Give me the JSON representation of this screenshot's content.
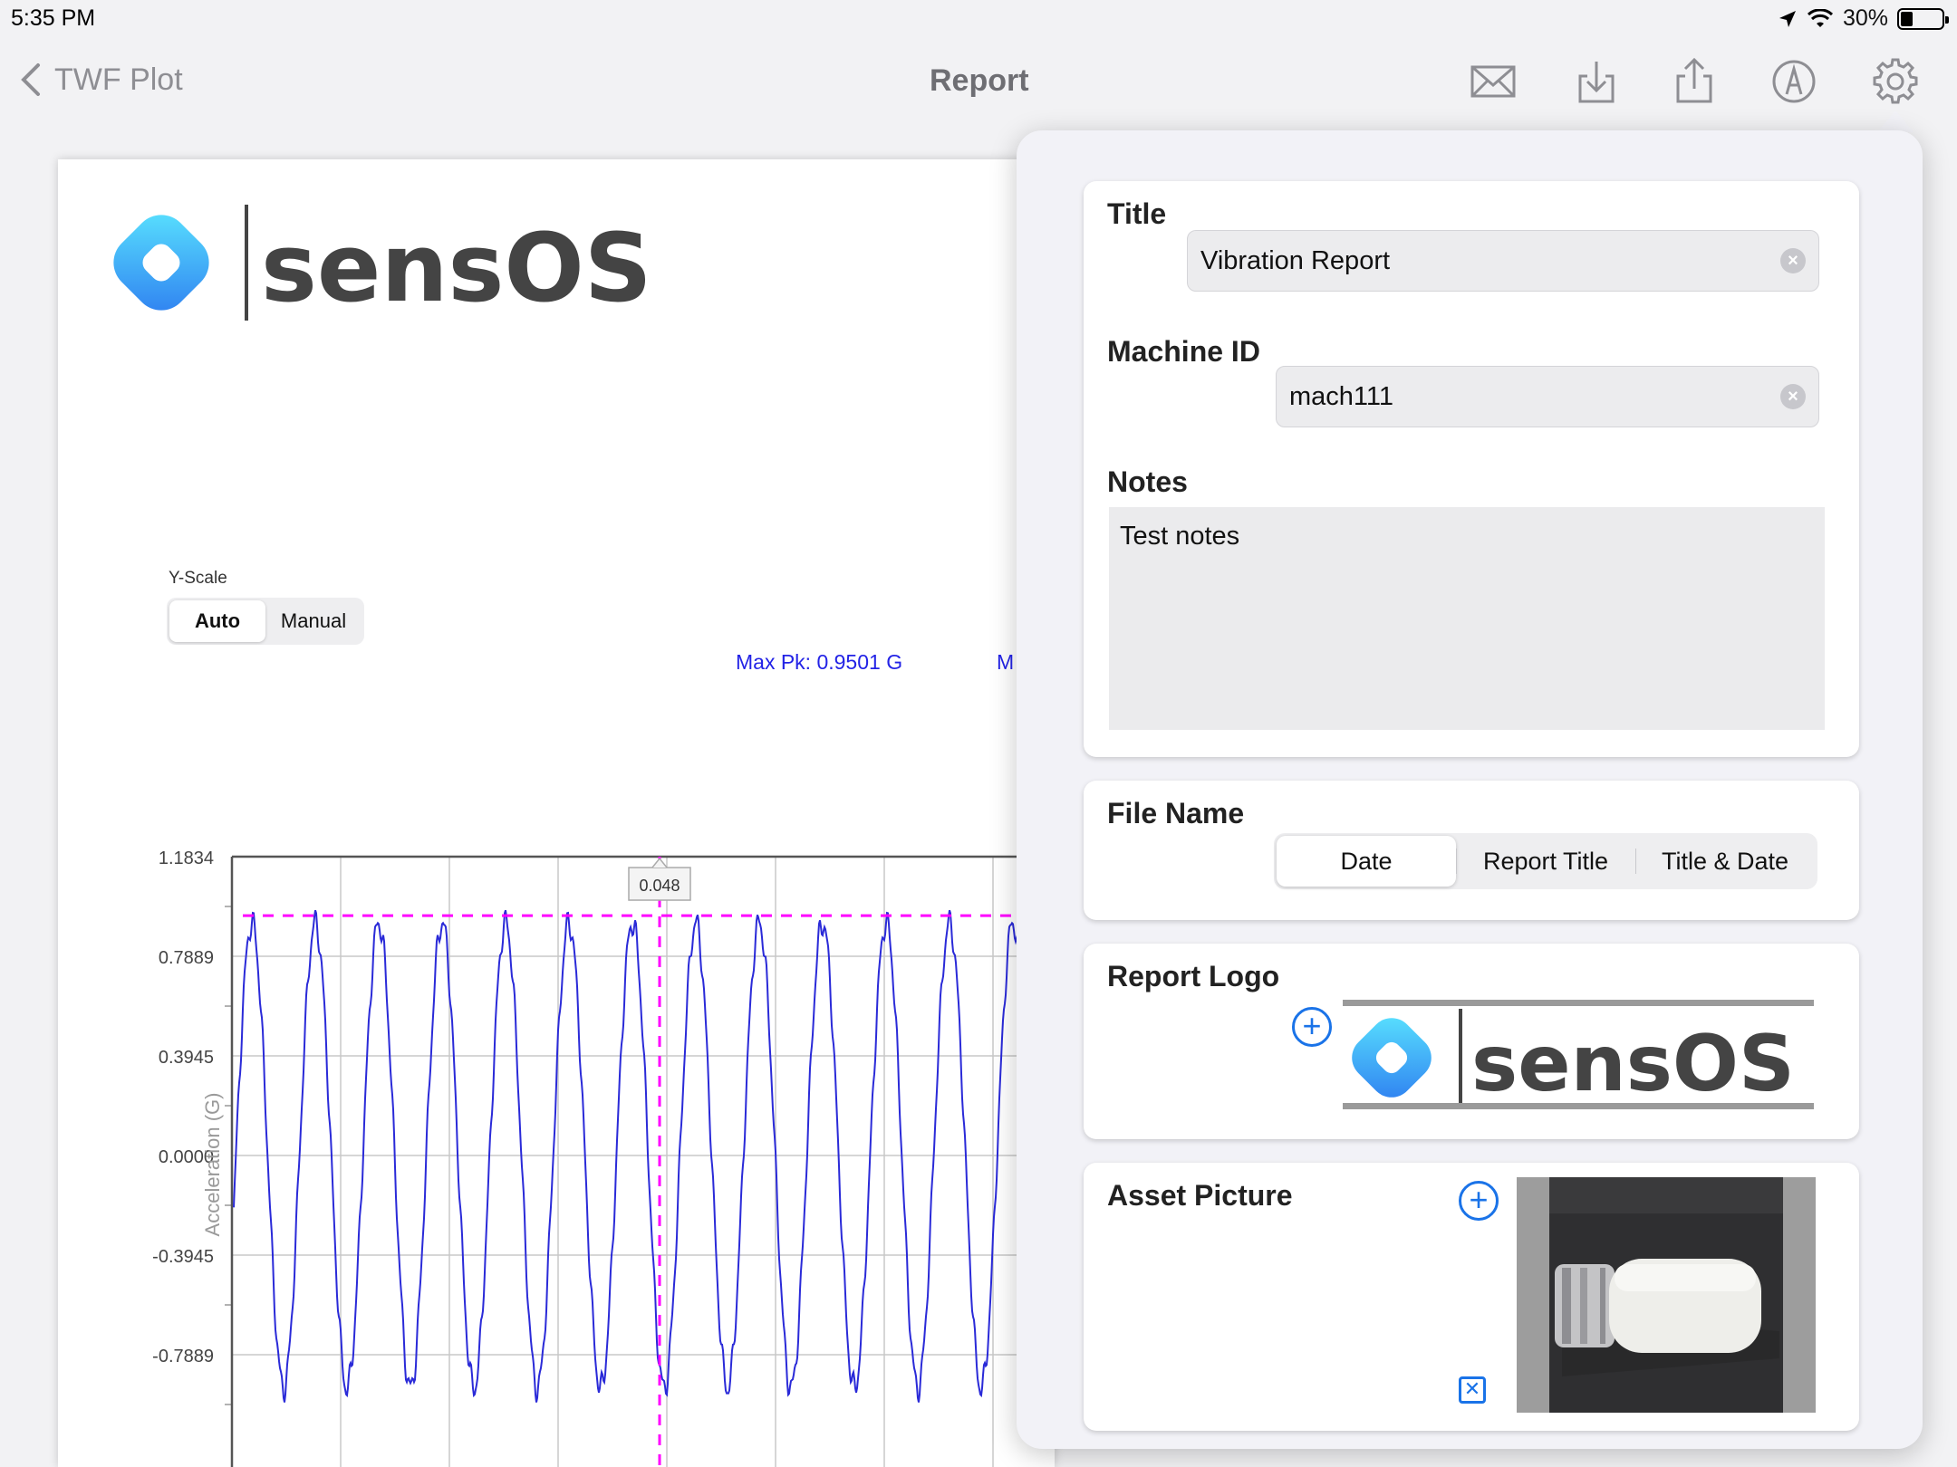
{
  "status_bar": {
    "time": "5:35 PM",
    "battery": "30%",
    "battery_level": 0.3
  },
  "nav": {
    "back_label": "TWF Plot",
    "title": "Report",
    "icons": [
      "mail-icon",
      "download-icon",
      "share-icon",
      "markup-icon",
      "settings-icon"
    ]
  },
  "report": {
    "logo_text": "sensOS",
    "y_scale": {
      "label": "Y-Scale",
      "options": [
        "Auto",
        "Manual"
      ],
      "selected": "Auto"
    },
    "max_pk": "Max Pk: 0.9501 G",
    "max_pk_cut": "M",
    "cursor_value": "0.048"
  },
  "chart_data": {
    "type": "line",
    "ylabel": "Acceleration (G)",
    "ylim": [
      -1.1834,
      1.1834
    ],
    "y_ticks": [
      "1.1834",
      "0.7889",
      "0.3945",
      "0.0000",
      "-0.3945",
      "-0.7889"
    ],
    "series": [
      {
        "color": "#2a2ad8",
        "waveform": "periodic",
        "peak_amplitude": 0.95,
        "cycles_visible": 11
      }
    ],
    "max_peak_line": 0.9501,
    "cursor_x": 0.048,
    "colors": {
      "trace": "#2a2ad8",
      "marker": "#ff00ff",
      "grid": "#c8c8c8"
    }
  },
  "settings_panel": {
    "title_label": "Title",
    "title_value": "Vibration Report",
    "machine_id_label": "Machine ID",
    "machine_id_value": "mach111",
    "notes_label": "Notes",
    "notes_value": "Test notes",
    "file_name": {
      "label": "File Name",
      "options": [
        "Date",
        "Report Title",
        "Title & Date"
      ],
      "selected": "Date"
    },
    "report_logo_label": "Report Logo",
    "report_logo_text": "sensOS",
    "asset_picture_label": "Asset Picture"
  },
  "colors": {
    "accent": "#1a73e8",
    "logo_gradient_a": "#5be6ff",
    "logo_gradient_b": "#2d7cf0",
    "logo_text": "#444444"
  }
}
